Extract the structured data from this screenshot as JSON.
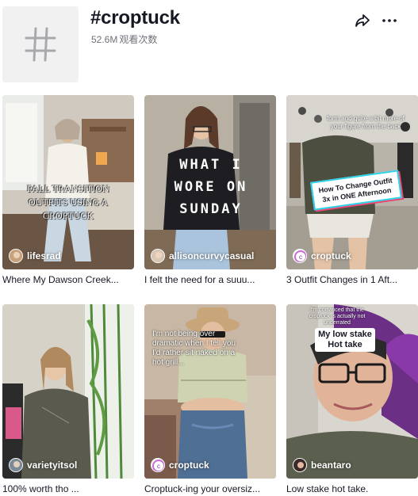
{
  "hashtag": {
    "title": "#croptuck",
    "views_count": "52.6M",
    "views_label": "观看次数",
    "thumb_icon": "hash-icon"
  },
  "actions": {
    "share_icon": "share-icon",
    "more_icon": "more-dots-icon"
  },
  "videos": [
    {
      "author": "lifesrad",
      "caption": "Where My Dawson Creek...",
      "overlay_text": "FALL TRANSITION OUTFITS USING A CROPTUCK"
    },
    {
      "author": "allisoncurvycasual",
      "caption": "I felt the need for a suuu...",
      "overlay_text": "WHAT I WORE ON SUNDAY"
    },
    {
      "author": "croptuck",
      "caption": "3 Outfit Changes in 1 Aft...",
      "overlay_small": "form and quite a bit more of your figure from the back",
      "overlay_text": "How To Change Outfit 3x in ONE Afternoon"
    },
    {
      "author": "varietyitsol",
      "caption": "100% worth tho ..."
    },
    {
      "author": "croptuck",
      "caption": "Croptuck-ing your oversiz...",
      "overlay_text": "I'm not being over dramatic when I tell you I'd rather sit naked on a hot grill..."
    },
    {
      "author": "beantaro",
      "caption": "Low stake hot take.",
      "overlay_small": "I'm convinced that the croptuck is actually not underrated",
      "overlay_text": "My low stake Hot take"
    }
  ],
  "colors": {
    "text_primary": "#161823",
    "text_secondary": "#6f7079",
    "thumb_bg": "#f1f1f2",
    "accent_cyan": "#2bd2e8",
    "accent_pink": "#e8466e"
  }
}
